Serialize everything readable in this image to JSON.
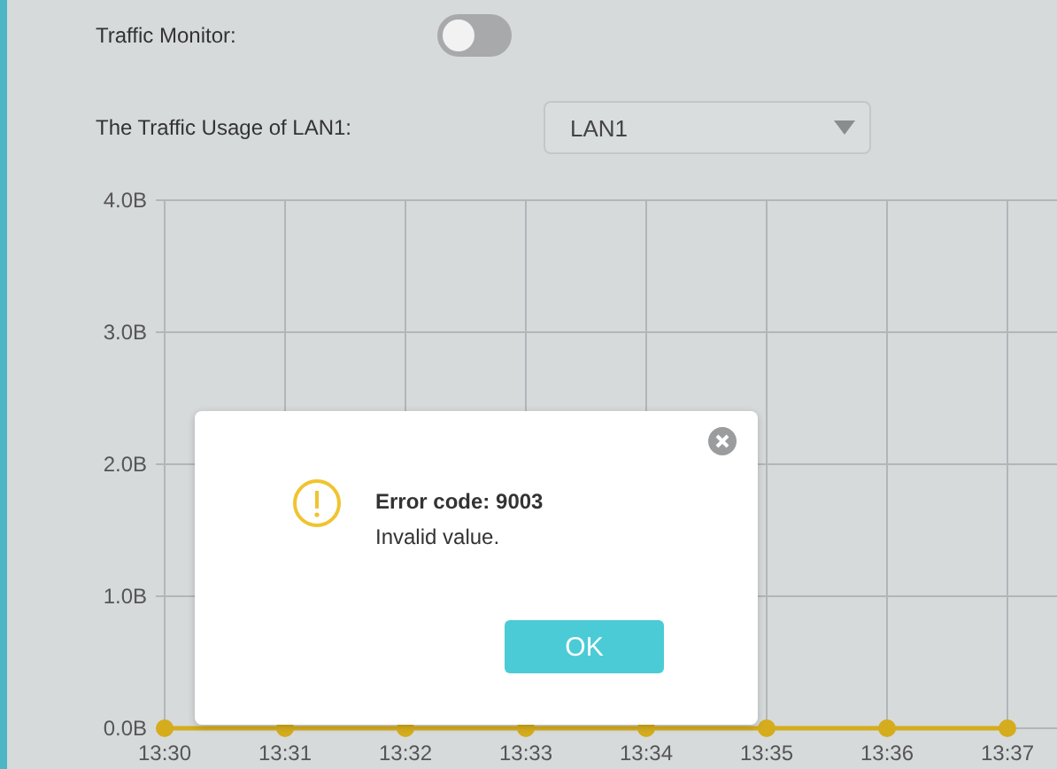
{
  "traffic_monitor": {
    "label": "Traffic Monitor:",
    "on": false
  },
  "usage": {
    "label": "The Traffic Usage of LAN1:",
    "value": "LAN1"
  },
  "chart": {
    "chart_data": {
      "type": "line",
      "grid": true,
      "categories": [
        "13:30",
        "13:31",
        "13:32",
        "13:33",
        "13:34",
        "13:35",
        "13:36",
        "13:37"
      ],
      "ylim": [
        0,
        4
      ],
      "yticks": [
        {
          "value": 0,
          "label": "0.0B"
        },
        {
          "value": 1,
          "label": "1.0B"
        },
        {
          "value": 2,
          "label": "2.0B"
        },
        {
          "value": 3,
          "label": "3.0B"
        },
        {
          "value": 4,
          "label": "4.0B"
        }
      ],
      "series": [
        {
          "color": "#d4ac1c",
          "marker": true,
          "values": [
            0,
            0,
            0,
            0,
            0,
            0,
            0,
            0
          ]
        }
      ]
    }
  },
  "dialog": {
    "title": "Error code: 9003",
    "message": "Invalid value.",
    "button": "OK"
  }
}
